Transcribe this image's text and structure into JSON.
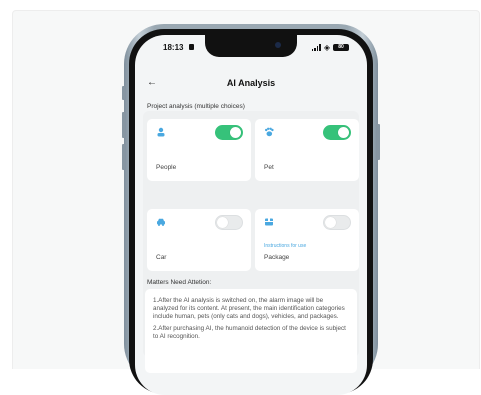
{
  "status": {
    "time": "18:13",
    "battery": "80"
  },
  "header": {
    "back_icon": "back-arrow-icon",
    "title": "AI Analysis"
  },
  "project": {
    "label": "Project analysis (multiple choices)",
    "options": [
      {
        "name": "People",
        "icon": "person-icon",
        "enabled": true,
        "hint": ""
      },
      {
        "name": "Pet",
        "icon": "pet-icon",
        "enabled": true,
        "hint": ""
      },
      {
        "name": "Car",
        "icon": "car-icon",
        "enabled": false,
        "hint": ""
      },
      {
        "name": "Package",
        "icon": "package-icon",
        "enabled": false,
        "hint": "Instructions for use"
      }
    ]
  },
  "attention": {
    "label": "Matters Need Attetion:",
    "paragraphs": [
      "1.After the AI analysis is switched on, the alarm image will be analyzed for its content. At present, the main identification categories include human, pets (only cats and dogs), vehicles, and packages.",
      "2.After purchasing AI, the humanoid detection of the device is subject to AI recognition."
    ]
  },
  "colors": {
    "toggle_on": "#36c27a",
    "accent_icon": "#4aa8e0",
    "hint_text": "#4aa8e0"
  }
}
